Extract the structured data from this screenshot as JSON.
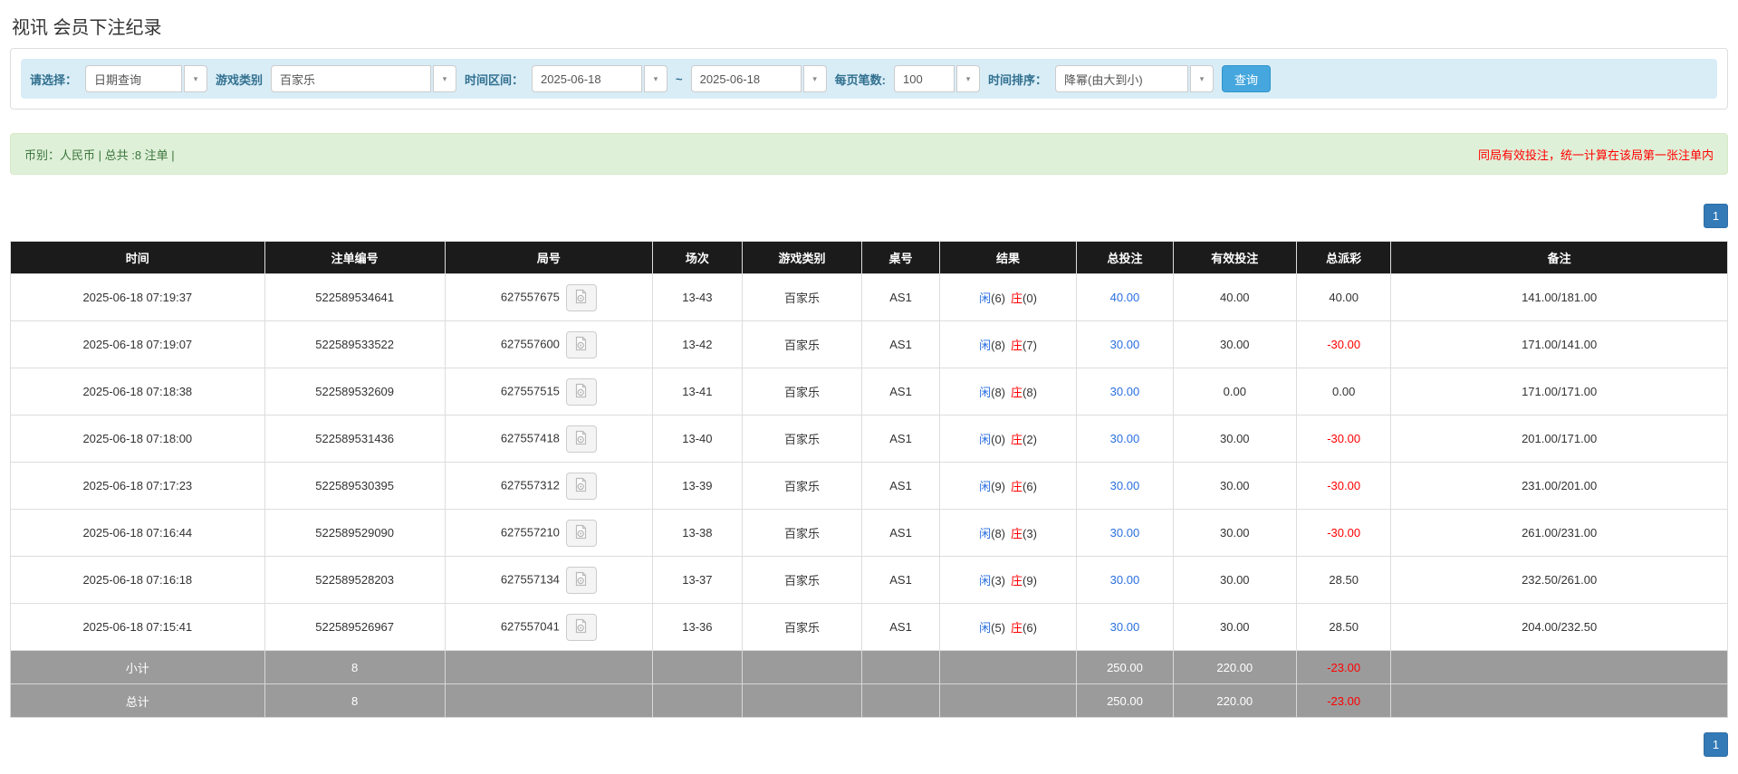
{
  "page": {
    "title": "视讯 会员下注纪录"
  },
  "filters": {
    "query_type_label": "请选择：",
    "query_type_value": "日期查询",
    "game_type_label": "游戏类别",
    "game_type_value": "百家乐",
    "time_range_label": "时间区间：",
    "date_from": "2025-06-18",
    "date_separator": "~",
    "date_to": "2025-06-18",
    "page_size_label": "每页笔数:",
    "page_size_value": "100",
    "sort_label": "时间排序：",
    "sort_value": "降幂(由大到小)",
    "search_button": "查询"
  },
  "summary": {
    "left_text": "币别：人民币 | 总共 :8 注单 |",
    "right_text": "同局有效投注，统一计算在该局第一张注单内"
  },
  "pagination": {
    "current": "1"
  },
  "table": {
    "headers": [
      "时间",
      "注单编号",
      "局号",
      "场次",
      "游戏类别",
      "桌号",
      "结果",
      "总投注",
      "有效投注",
      "总派彩",
      "备注"
    ],
    "rows": [
      {
        "time": "2025-06-18 07:19:37",
        "bet_id": "522589534641",
        "round_id": "627557675",
        "session": "13-43",
        "game": "百家乐",
        "table_no": "AS1",
        "result": {
          "player_label": "闲",
          "player_score": "(6)",
          "banker_label": "庄",
          "banker_score": "(0)"
        },
        "total_bet": "40.00",
        "valid_bet": "40.00",
        "payout": "40.00",
        "remark": "141.00/181.00"
      },
      {
        "time": "2025-06-18 07:19:07",
        "bet_id": "522589533522",
        "round_id": "627557600",
        "session": "13-42",
        "game": "百家乐",
        "table_no": "AS1",
        "result": {
          "player_label": "闲",
          "player_score": "(8)",
          "banker_label": "庄",
          "banker_score": "(7)"
        },
        "total_bet": "30.00",
        "valid_bet": "30.00",
        "payout": "-30.00",
        "remark": "171.00/141.00"
      },
      {
        "time": "2025-06-18 07:18:38",
        "bet_id": "522589532609",
        "round_id": "627557515",
        "session": "13-41",
        "game": "百家乐",
        "table_no": "AS1",
        "result": {
          "player_label": "闲",
          "player_score": "(8)",
          "banker_label": "庄",
          "banker_score": "(8)"
        },
        "total_bet": "30.00",
        "valid_bet": "0.00",
        "payout": "0.00",
        "remark": "171.00/171.00"
      },
      {
        "time": "2025-06-18 07:18:00",
        "bet_id": "522589531436",
        "round_id": "627557418",
        "session": "13-40",
        "game": "百家乐",
        "table_no": "AS1",
        "result": {
          "player_label": "闲",
          "player_score": "(0)",
          "banker_label": "庄",
          "banker_score": "(2)"
        },
        "total_bet": "30.00",
        "valid_bet": "30.00",
        "payout": "-30.00",
        "remark": "201.00/171.00"
      },
      {
        "time": "2025-06-18 07:17:23",
        "bet_id": "522589530395",
        "round_id": "627557312",
        "session": "13-39",
        "game": "百家乐",
        "table_no": "AS1",
        "result": {
          "player_label": "闲",
          "player_score": "(9)",
          "banker_label": "庄",
          "banker_score": "(6)"
        },
        "total_bet": "30.00",
        "valid_bet": "30.00",
        "payout": "-30.00",
        "remark": "231.00/201.00"
      },
      {
        "time": "2025-06-18 07:16:44",
        "bet_id": "522589529090",
        "round_id": "627557210",
        "session": "13-38",
        "game": "百家乐",
        "table_no": "AS1",
        "result": {
          "player_label": "闲",
          "player_score": "(8)",
          "banker_label": "庄",
          "banker_score": "(3)"
        },
        "total_bet": "30.00",
        "valid_bet": "30.00",
        "payout": "-30.00",
        "remark": "261.00/231.00"
      },
      {
        "time": "2025-06-18 07:16:18",
        "bet_id": "522589528203",
        "round_id": "627557134",
        "session": "13-37",
        "game": "百家乐",
        "table_no": "AS1",
        "result": {
          "player_label": "闲",
          "player_score": "(3)",
          "banker_label": "庄",
          "banker_score": "(9)"
        },
        "total_bet": "30.00",
        "valid_bet": "30.00",
        "payout": "28.50",
        "remark": "232.50/261.00"
      },
      {
        "time": "2025-06-18 07:15:41",
        "bet_id": "522589526967",
        "round_id": "627557041",
        "session": "13-36",
        "game": "百家乐",
        "table_no": "AS1",
        "result": {
          "player_label": "闲",
          "player_score": "(5)",
          "banker_label": "庄",
          "banker_score": "(6)"
        },
        "total_bet": "30.00",
        "valid_bet": "30.00",
        "payout": "28.50",
        "remark": "204.00/232.50"
      }
    ],
    "subtotal": {
      "label": "小计",
      "count": "8",
      "total_bet": "250.00",
      "valid_bet": "220.00",
      "payout": "-23.00"
    },
    "total": {
      "label": "总计",
      "count": "8",
      "total_bet": "250.00",
      "valid_bet": "220.00",
      "payout": "-23.00"
    }
  },
  "colors": {
    "header_bg": "#1b1b1b",
    "footer_bg": "#9b9b9b",
    "player_blue": "#2a6fe0",
    "banker_red": "#ff0000",
    "negative_red": "#ff0000",
    "link_blue": "#2a6fe0",
    "filter_bg": "#d9edf7",
    "summary_bg": "#dff0d8",
    "search_button_blue": "#45a7dd",
    "pagination_blue": "#337ab7"
  },
  "icons": {
    "chevron": "▾"
  }
}
